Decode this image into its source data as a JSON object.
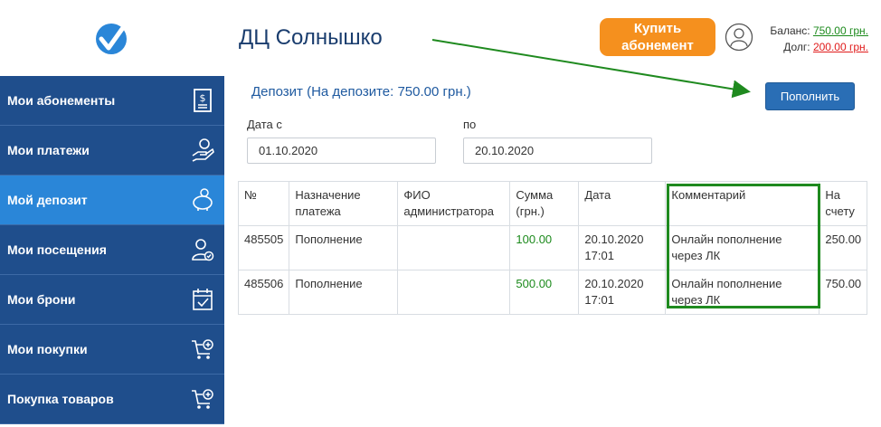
{
  "sidebar": {
    "items": [
      {
        "label": "Мои абонементы",
        "icon": "receipt-icon",
        "active": false
      },
      {
        "label": "Мои платежи",
        "icon": "hand-coin-icon",
        "active": false
      },
      {
        "label": "Мой депозит",
        "icon": "piggy-bank-icon",
        "active": true
      },
      {
        "label": "Мои посещения",
        "icon": "user-check-icon",
        "active": false
      },
      {
        "label": "Мои брони",
        "icon": "calendar-check-icon",
        "active": false
      },
      {
        "label": "Мои покупки",
        "icon": "cart-plus-icon",
        "active": false
      },
      {
        "label": "Покупка товаров",
        "icon": "cart-plus-icon",
        "active": false
      }
    ]
  },
  "header": {
    "title": "ДЦ Солнышко",
    "buy_button": "Купить абонемент",
    "balance_label": "Баланс:",
    "balance_value": "750.00 грн.",
    "debt_label": "Долг:",
    "debt_value": "200.00 грн."
  },
  "deposit": {
    "title": "Депозит (На депозите: 750.00 грн.)",
    "topup_button": "Пополнить",
    "date_from_label": "Дата с",
    "date_from_value": "01.10.2020",
    "date_to_label": "по",
    "date_to_value": "20.10.2020"
  },
  "table": {
    "headers": [
      "№",
      "Назначение платежа",
      "ФИО администратора",
      "Сумма (грн.)",
      "Дата",
      "Комментарий",
      "На счету"
    ],
    "rows": [
      [
        "485505",
        "Пополнение",
        "",
        "100.00",
        "20.10.2020 17:01",
        "Онлайн пополнение через ЛК",
        "250.00"
      ],
      [
        "485506",
        "Пополнение",
        "",
        "500.00",
        "20.10.2020 17:01",
        "Онлайн пополнение через ЛК",
        "750.00"
      ]
    ]
  },
  "colors": {
    "sidebar": "#1f4e8c",
    "sidebar_active": "#2a86d8",
    "buy_button": "#f5901e",
    "topup_button": "#2a6eb5",
    "highlight": "#1f8a1f"
  }
}
